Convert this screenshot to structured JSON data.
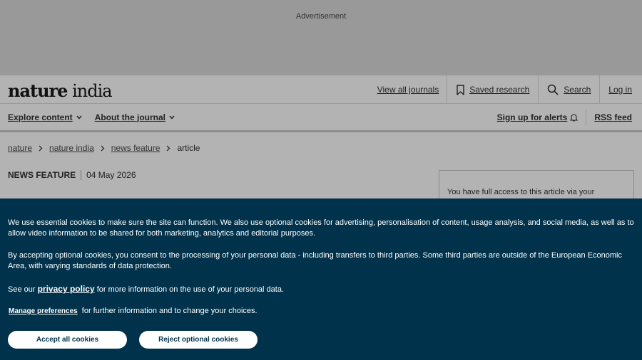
{
  "ad": {
    "label": "Advertisement"
  },
  "header": {
    "logo_bold": "nature",
    "logo_rest": " india",
    "links": {
      "view_journals": "View all journals",
      "saved_research": "Saved research",
      "search": "Search",
      "login": "Log in"
    }
  },
  "subnav": {
    "explore": "Explore content",
    "about": "About the journal",
    "alerts": "Sign up for alerts",
    "rss": "RSS feed"
  },
  "breadcrumb": [
    "nature",
    "nature india",
    "news feature",
    "article"
  ],
  "article": {
    "type": "NEWS FEATURE",
    "date": "04 May 2026",
    "access_text": "You have full access to this article via your"
  },
  "cookie": {
    "p1": "We use essential cookies to make sure the site can function. We also use optional cookies for advertising, personalisation of content, usage analysis, and social media, as well as to allow video information to be shared for both marketing, analytics and editorial purposes.",
    "p2": "By accepting optional cookies, you consent to the processing of your personal data - including transfers to third parties. Some third parties are outside of the European Economic Area, with varying standards of data protection.",
    "p3_before": "See our ",
    "p3_link": "privacy policy",
    "p3_after": " for more information on the use of your personal data.",
    "p4_link": "Manage preferences",
    "p4_after": " for further information and to change your choices.",
    "accept": "Accept all cookies",
    "reject": "Reject optional cookies"
  }
}
